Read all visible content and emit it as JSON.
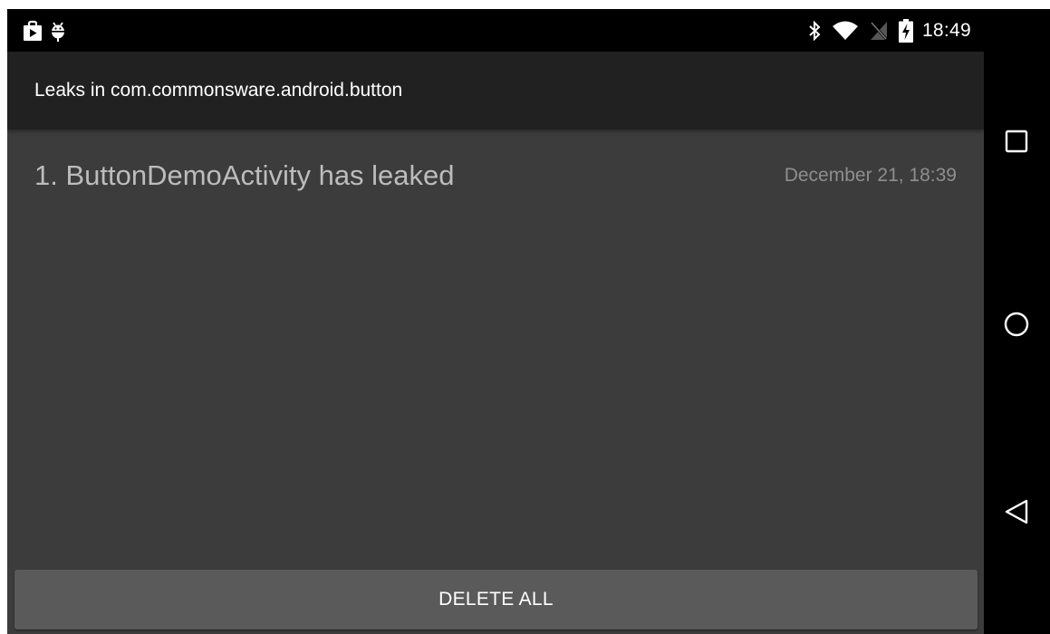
{
  "status_bar": {
    "left_icons": [
      "shopping-bag-icon",
      "android-debug-icon"
    ],
    "right_icons": [
      "bluetooth-icon",
      "wifi-icon",
      "no-sim-icon",
      "battery-charging-icon"
    ],
    "time": "18:49"
  },
  "action_bar": {
    "title": "Leaks in com.commonsware.android.button"
  },
  "leaks": [
    {
      "label": "1. ButtonDemoActivity has leaked",
      "time": "December 21, 18:39"
    }
  ],
  "delete_all_label": "DELETE ALL",
  "nav_bar": {
    "buttons": [
      "recents-icon",
      "home-icon",
      "back-icon"
    ]
  },
  "colors": {
    "status_bar": "#000000",
    "action_bar": "#212121",
    "content_bg": "#3c3c3c",
    "button_bg": "#5a5a5b",
    "primary_text": "#ffffff",
    "list_text": "#bcbcbc",
    "secondary_text": "#8e8e8e"
  }
}
